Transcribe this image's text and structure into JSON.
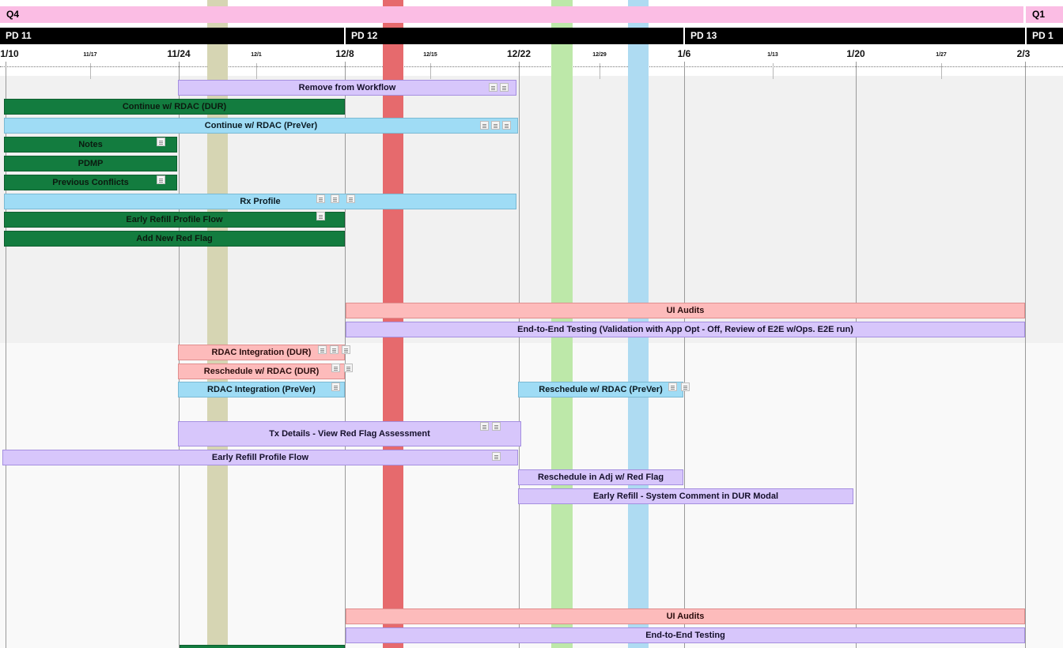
{
  "timeline": {
    "quarters": [
      {
        "label": "Q4"
      },
      {
        "label": "Q1"
      }
    ],
    "periods": [
      {
        "label": "PD 11"
      },
      {
        "label": "PD 12"
      },
      {
        "label": "PD 13"
      },
      {
        "label": "PD 1"
      }
    ],
    "ticks": [
      {
        "label": "1/10",
        "major": true
      },
      {
        "label": "11/17",
        "major": false
      },
      {
        "label": "11/24",
        "major": true
      },
      {
        "label": "12/1",
        "major": false
      },
      {
        "label": "12/8",
        "major": true
      },
      {
        "label": "12/15",
        "major": false
      },
      {
        "label": "12/22",
        "major": true
      },
      {
        "label": "12/29",
        "major": false
      },
      {
        "label": "1/6",
        "major": true
      },
      {
        "label": "1/13",
        "major": false
      },
      {
        "label": "1/20",
        "major": true
      },
      {
        "label": "1/27",
        "major": false
      },
      {
        "label": "2/3",
        "major": true
      }
    ]
  },
  "stripes": [
    {
      "color": "#d6d5b3"
    },
    {
      "color": "#e66a6d"
    },
    {
      "color": "#bde8a9"
    },
    {
      "color": "#aedbf2"
    }
  ],
  "tasks": [
    {
      "label": "Remove from Workflow",
      "color": "purple",
      "notes": 2
    },
    {
      "label": "Continue w/ RDAC (DUR)",
      "color": "green",
      "notes": 0
    },
    {
      "label": "Continue w/ RDAC (PreVer)",
      "color": "blue",
      "notes": 3
    },
    {
      "label": "Notes",
      "color": "green",
      "notes": 1
    },
    {
      "label": "PDMP",
      "color": "green",
      "notes": 0
    },
    {
      "label": "Previous Conflicts",
      "color": "green",
      "notes": 1
    },
    {
      "label": "Rx Profile",
      "color": "blue",
      "notes": 3
    },
    {
      "label": "Early Refill Profile Flow",
      "color": "green",
      "notes": 1
    },
    {
      "label": "Add New Red Flag",
      "color": "green",
      "notes": 0
    },
    {
      "label": "UI Audits",
      "color": "pink",
      "notes": 0
    },
    {
      "label": "End-to-End Testing (Validation with App Opt - Off, Review of E2E w/Ops. E2E run)",
      "color": "purple",
      "notes": 0
    },
    {
      "label": "RDAC Integration (DUR)",
      "color": "pink",
      "notes": 3
    },
    {
      "label": "Reschedule w/ RDAC (DUR)",
      "color": "pink",
      "notes": 2
    },
    {
      "label": "RDAC Integration (PreVer)",
      "color": "blue",
      "notes": 1
    },
    {
      "label": "Reschedule w/ RDAC (PreVer)",
      "color": "blue",
      "notes": 2
    },
    {
      "label": "Tx Details - View Red Flag Assessment",
      "color": "purple",
      "notes": 2
    },
    {
      "label": "Early Refill Profile Flow",
      "color": "purple",
      "notes": 1
    },
    {
      "label": "Reschedule in Adj w/ Red Flag",
      "color": "purple",
      "notes": 0
    },
    {
      "label": "Early Refill - System Comment in DUR Modal",
      "color": "purple",
      "notes": 0
    },
    {
      "label": "UI Audits",
      "color": "pink",
      "notes": 0
    },
    {
      "label": "End-to-End Testing",
      "color": "purple",
      "notes": 0
    },
    {
      "label": "",
      "color": "green",
      "notes": 0
    }
  ]
}
